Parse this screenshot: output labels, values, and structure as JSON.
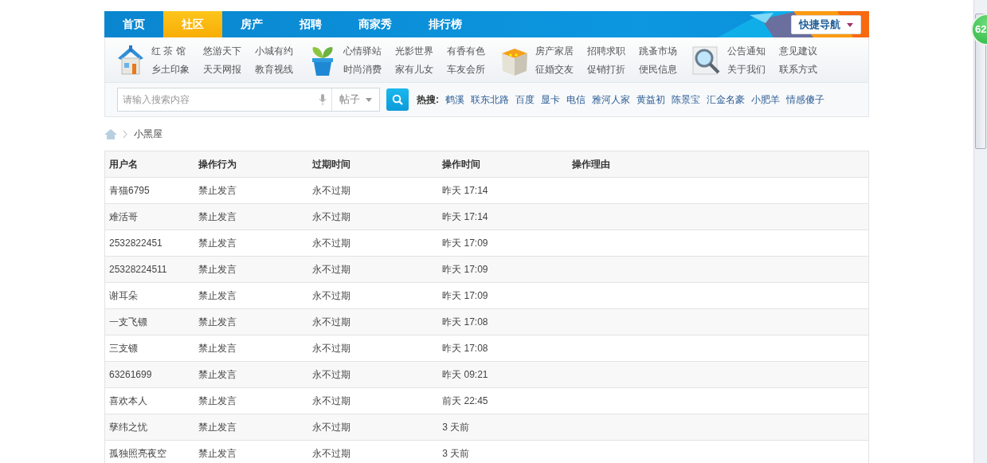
{
  "nav": {
    "tabs": [
      {
        "label": "首页",
        "selected": false
      },
      {
        "label": "社区",
        "selected": true
      },
      {
        "label": "房产",
        "selected": false
      },
      {
        "label": "招聘",
        "selected": false
      },
      {
        "label": "商家秀",
        "selected": false
      },
      {
        "label": "排行榜",
        "selected": false
      }
    ],
    "quick_nav": "快捷导航"
  },
  "categories": [
    {
      "kind": "house",
      "rows": [
        [
          "红 茶 馆",
          "悠游天下",
          "小城有约"
        ],
        [
          "乡土印象",
          "天天网报",
          "教育视线"
        ]
      ]
    },
    {
      "kind": "plant",
      "rows": [
        [
          "心情驿站",
          "光影世界",
          "有香有色"
        ],
        [
          "时尚消费",
          "家有儿女",
          "车友会所"
        ]
      ]
    },
    {
      "kind": "box",
      "rows": [
        [
          "房产家居",
          "招聘求职",
          "跳蚤市场"
        ],
        [
          "征婚交友",
          "促销打折",
          "便民信息"
        ]
      ]
    },
    {
      "kind": "magnifier",
      "rows": [
        [
          "公告通知",
          "意见建议"
        ],
        [
          "关于我们",
          "联系方式"
        ]
      ]
    }
  ],
  "search": {
    "placeholder": "请输入搜索内容",
    "scope": "帖子",
    "hot_label": "热搜:",
    "hot": [
      "鹤溪",
      "联东北路",
      "百度",
      "显卡",
      "电信",
      "雅河人家",
      "黄益初",
      "陈景宝",
      "汇金名豪",
      "小肥羊",
      "情感傻子"
    ]
  },
  "breadcrumb": {
    "current": "小黑屋"
  },
  "table": {
    "columns": [
      "用户名",
      "操作行为",
      "过期时间",
      "操作时间",
      "操作理由"
    ],
    "rows": [
      [
        "青猫6795",
        "禁止发言",
        "永不过期",
        "昨天 17:14"
      ],
      [
        "难活哥",
        "禁止发言",
        "永不过期",
        "昨天 17:14"
      ],
      [
        "2532822451",
        "禁止发言",
        "永不过期",
        "昨天 17:09"
      ],
      [
        "25328224511",
        "禁止发言",
        "永不过期",
        "昨天 17:09"
      ],
      [
        "谢耳朵",
        "禁止发言",
        "永不过期",
        "昨天 17:09"
      ],
      [
        "一支飞镖",
        "禁止发言",
        "永不过期",
        "昨天 17:08"
      ],
      [
        "三支镖",
        "禁止发言",
        "永不过期",
        "昨天 17:08"
      ],
      [
        "63261699",
        "禁止发言",
        "永不过期",
        "昨天 09:21"
      ],
      [
        "喜欢本人",
        "禁止发言",
        "永不过期",
        "前天 22:45"
      ],
      [
        "孳纬之忧",
        "禁止发言",
        "永不过期",
        "3 天前"
      ],
      [
        "孤独照亮夜空",
        "禁止发言",
        "永不过期",
        "3 天前"
      ]
    ]
  },
  "floating_badge": "62"
}
